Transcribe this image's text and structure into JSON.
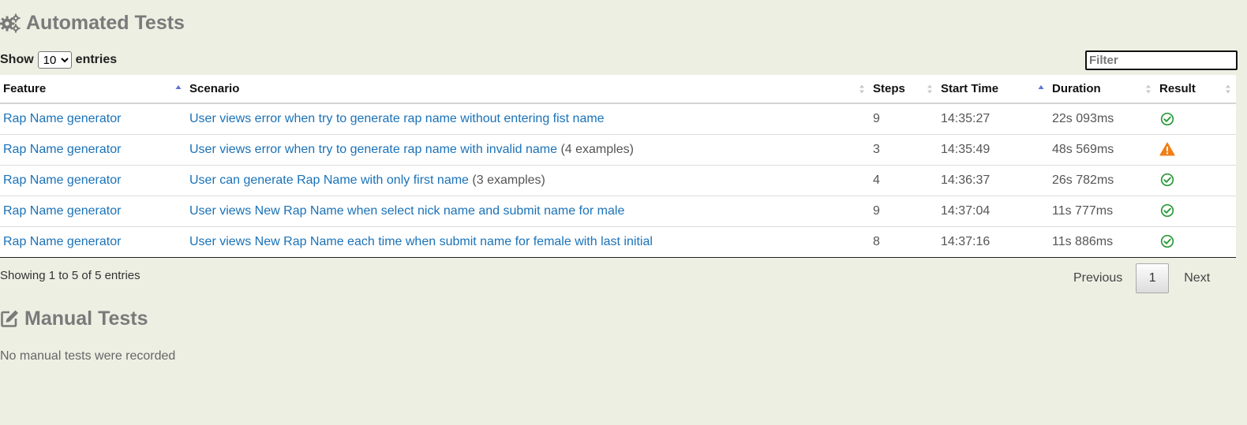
{
  "automated": {
    "title": "Automated Tests",
    "icon": "gears-icon"
  },
  "length_menu": {
    "prefix": "Show",
    "selected": "10",
    "suffix": "entries"
  },
  "filter": {
    "placeholder": "Filter"
  },
  "table": {
    "headers": {
      "feature": "Feature",
      "scenario": "Scenario",
      "steps": "Steps",
      "start_time": "Start Time",
      "duration": "Duration",
      "result": "Result"
    },
    "rows": [
      {
        "feature": "Rap Name generator",
        "scenario": "User views error when try to generate rap name without entering fist name",
        "examples": "",
        "steps": "9",
        "start_time": "14:35:27",
        "duration": "22s 093ms",
        "result": "passed"
      },
      {
        "feature": "Rap Name generator",
        "scenario": "User views error when try to generate rap name with invalid name",
        "examples": "(4 examples)",
        "steps": "3",
        "start_time": "14:35:49",
        "duration": "48s 569ms",
        "result": "warning"
      },
      {
        "feature": "Rap Name generator",
        "scenario": "User can generate Rap Name with only first name",
        "examples": "(3 examples)",
        "steps": "4",
        "start_time": "14:36:37",
        "duration": "26s 782ms",
        "result": "passed"
      },
      {
        "feature": "Rap Name generator",
        "scenario": "User views New Rap Name when select nick name and submit name for male",
        "examples": "",
        "steps": "9",
        "start_time": "14:37:04",
        "duration": "11s 777ms",
        "result": "passed"
      },
      {
        "feature": "Rap Name generator",
        "scenario": "User views New Rap Name each time when submit name for female with last initial",
        "examples": "",
        "steps": "8",
        "start_time": "14:37:16",
        "duration": "11s 886ms",
        "result": "passed"
      }
    ]
  },
  "info": "Showing 1 to 5 of 5 entries",
  "pagination": {
    "previous": "Previous",
    "page": "1",
    "next": "Next"
  },
  "manual": {
    "title": "Manual Tests",
    "icon": "edit-icon",
    "empty_message": "No manual tests were recorded"
  },
  "colors": {
    "background": "#eeefe3",
    "link": "#1a72b8",
    "passed": "#2a9a3a",
    "warning": "#f07f16",
    "sort_active": "#5a74d6",
    "sort_inactive": "#c8c8c8"
  }
}
